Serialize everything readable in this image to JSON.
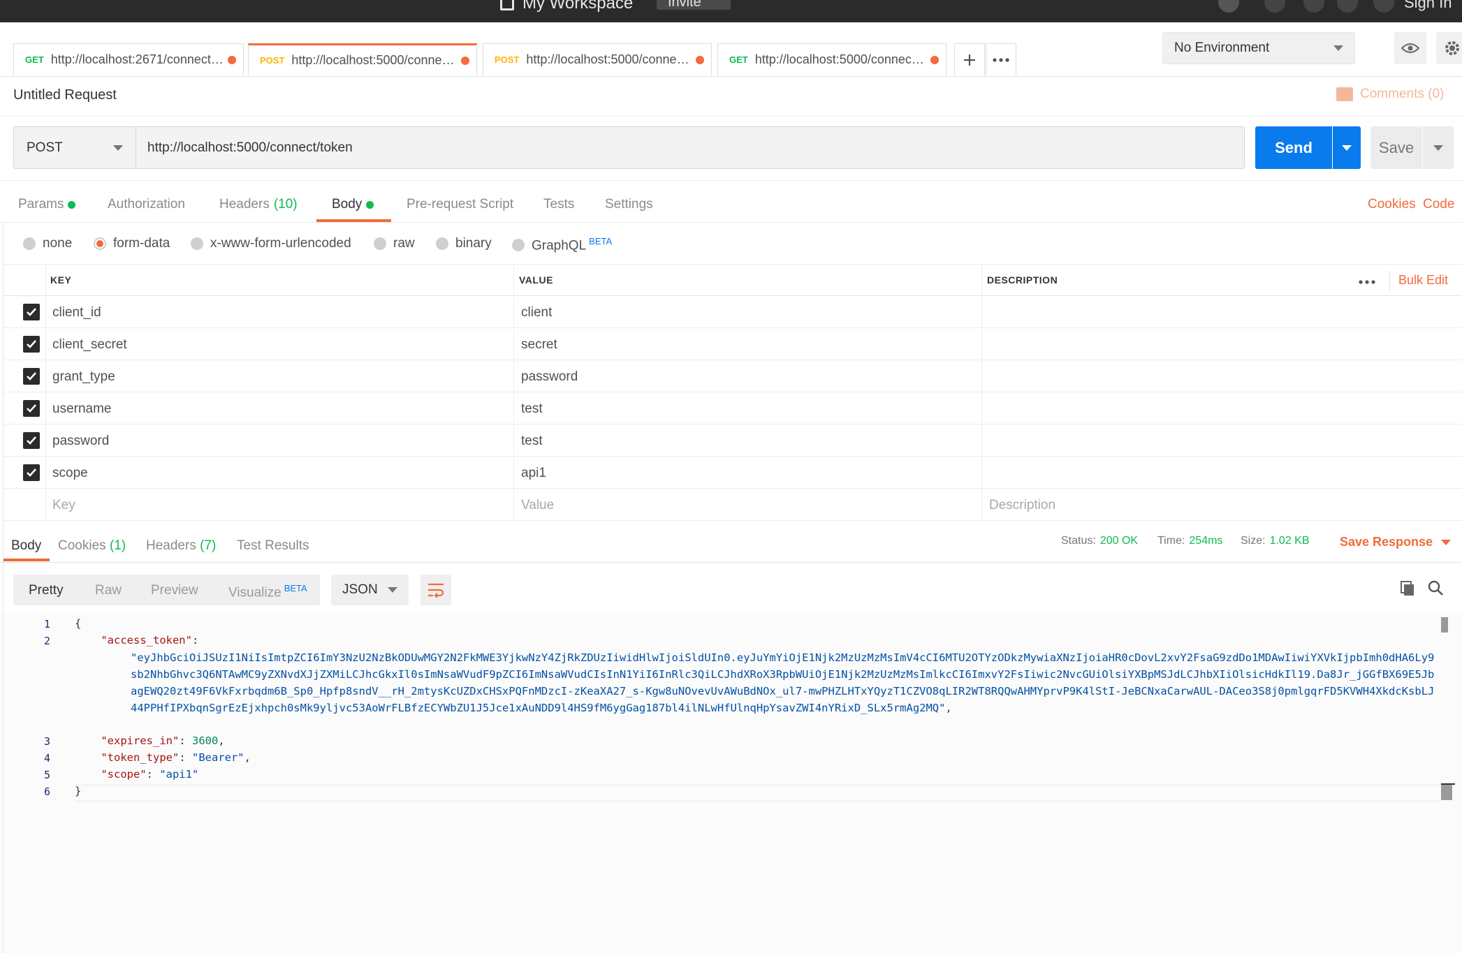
{
  "topbar": {
    "workspace": "My Workspace",
    "invite": "Invite",
    "signin": "Sign In"
  },
  "tabs": [
    {
      "method": "GET",
      "url": "http://localhost:2671/connect/t..."
    },
    {
      "method": "POST",
      "url": "http://localhost:5000/connect/..."
    },
    {
      "method": "POST",
      "url": "http://localhost:5000/connect/..."
    },
    {
      "method": "GET",
      "url": "http://localhost:5000/connect/u..."
    }
  ],
  "environment": {
    "selected": "No Environment"
  },
  "request": {
    "title": "Untitled Request",
    "comments": "Comments (0)",
    "method": "POST",
    "url": "http://localhost:5000/connect/token",
    "send": "Send",
    "save": "Save"
  },
  "subtabs": {
    "params": "Params",
    "authorization": "Authorization",
    "headers": "Headers",
    "headers_count": "(10)",
    "body": "Body",
    "prerequest": "Pre-request Script",
    "tests": "Tests",
    "settings": "Settings",
    "cookies": "Cookies",
    "code": "Code"
  },
  "body_types": {
    "none": "none",
    "form_data": "form-data",
    "urlencoded": "x-www-form-urlencoded",
    "raw": "raw",
    "binary": "binary",
    "graphql": "GraphQL",
    "beta": "BETA"
  },
  "table": {
    "headers": {
      "key": "KEY",
      "value": "VALUE",
      "description": "DESCRIPTION",
      "bulk_edit": "Bulk Edit"
    },
    "rows": [
      {
        "key": "client_id",
        "value": "client"
      },
      {
        "key": "client_secret",
        "value": "secret"
      },
      {
        "key": "grant_type",
        "value": "password"
      },
      {
        "key": "username",
        "value": "test"
      },
      {
        "key": "password",
        "value": "test"
      },
      {
        "key": "scope",
        "value": "api1"
      }
    ],
    "placeholders": {
      "key": "Key",
      "value": "Value",
      "description": "Description"
    }
  },
  "response": {
    "tabs": {
      "body": "Body",
      "cookies": "Cookies",
      "cookies_count": "(1)",
      "headers": "Headers",
      "headers_count": "(7)",
      "tests": "Test Results"
    },
    "status_label": "Status:",
    "status": "200 OK",
    "time_label": "Time:",
    "time": "254ms",
    "size_label": "Size:",
    "size": "1.02 KB",
    "save_response": "Save Response",
    "views": {
      "pretty": "Pretty",
      "raw": "Raw",
      "preview": "Preview",
      "visualize": "Visualize",
      "beta": "BETA"
    },
    "format": "JSON",
    "json": {
      "access_token_key": "\"access_token\"",
      "access_token_value": "\"eyJhbGciOiJSUzI1NiIsImtpZCI6ImY3NzU2NzBkODUwMGY2N2FkMWE3YjkwNzY4ZjRkZDUzIiwidHlwIjoiSldUIn0.eyJuYmYiOjE1Njk2MzUzMzMsImV4cCI6MTU2OTYzODkzMywiaXNzIjoiaHR0cDovL2xvY2FsaG9zdDo1MDAwIiwiYXVkIjpbImh0dHA6Ly9sb2NhbGhvc3Q6NTAwMC9yZXNvdXJjZXMiLCJhcGkxIl0sImNsaWVudF9pZCI6ImNsaWVudCIsInN1YiI6InRlc3QiLCJhdXRoX3RpbWUiOjE1Njk2MzUzMzMsImlkcCI6ImxvY2FsIiwic2NvcGUiOlsiYXBpMSJdLCJhbXIiOlsicHdkIl19.Da8Jr_jGGfBX69E5JbagEWQ20zt49F6VkFxrbqdm6B_Sp0_Hpfp8sndV__rH_2mtysKcUZDxCHSxPQFnMDzcI-zKeaXA27_s-Kgw8uNOvevUvAWuBdNOx_ul7-mwPHZLHTxYQyzT1CZVO8qLIR2WT8RQQwAHMYprvP9K4lStI-JeBCNxaCarwAUL-DACeo3S8j0pmlgqrFD5KVWH4XkdcKsbLJ44PPHfIPXbqnSgrEzEjxhpch0sMk9yljvc53AoWrFLBfzECYWbZU1J5Jce1xAuNDD9l4HS9fM6ygGag187bl4ilNLwHfUlnqHpYsavZWI4nYRixD_SLx5rmAg2MQ\"",
      "expires_in_key": "\"expires_in\"",
      "expires_in_value": "3600",
      "token_type_key": "\"token_type\"",
      "token_type_value": "\"Bearer\"",
      "scope_key": "\"scope\"",
      "scope_value": "\"api1\""
    },
    "line_numbers": [
      "1",
      "2",
      "3",
      "4",
      "5",
      "6"
    ]
  },
  "colors": {
    "accent": "#f26b3a",
    "send": "#097bed",
    "success": "#0cbb52"
  }
}
